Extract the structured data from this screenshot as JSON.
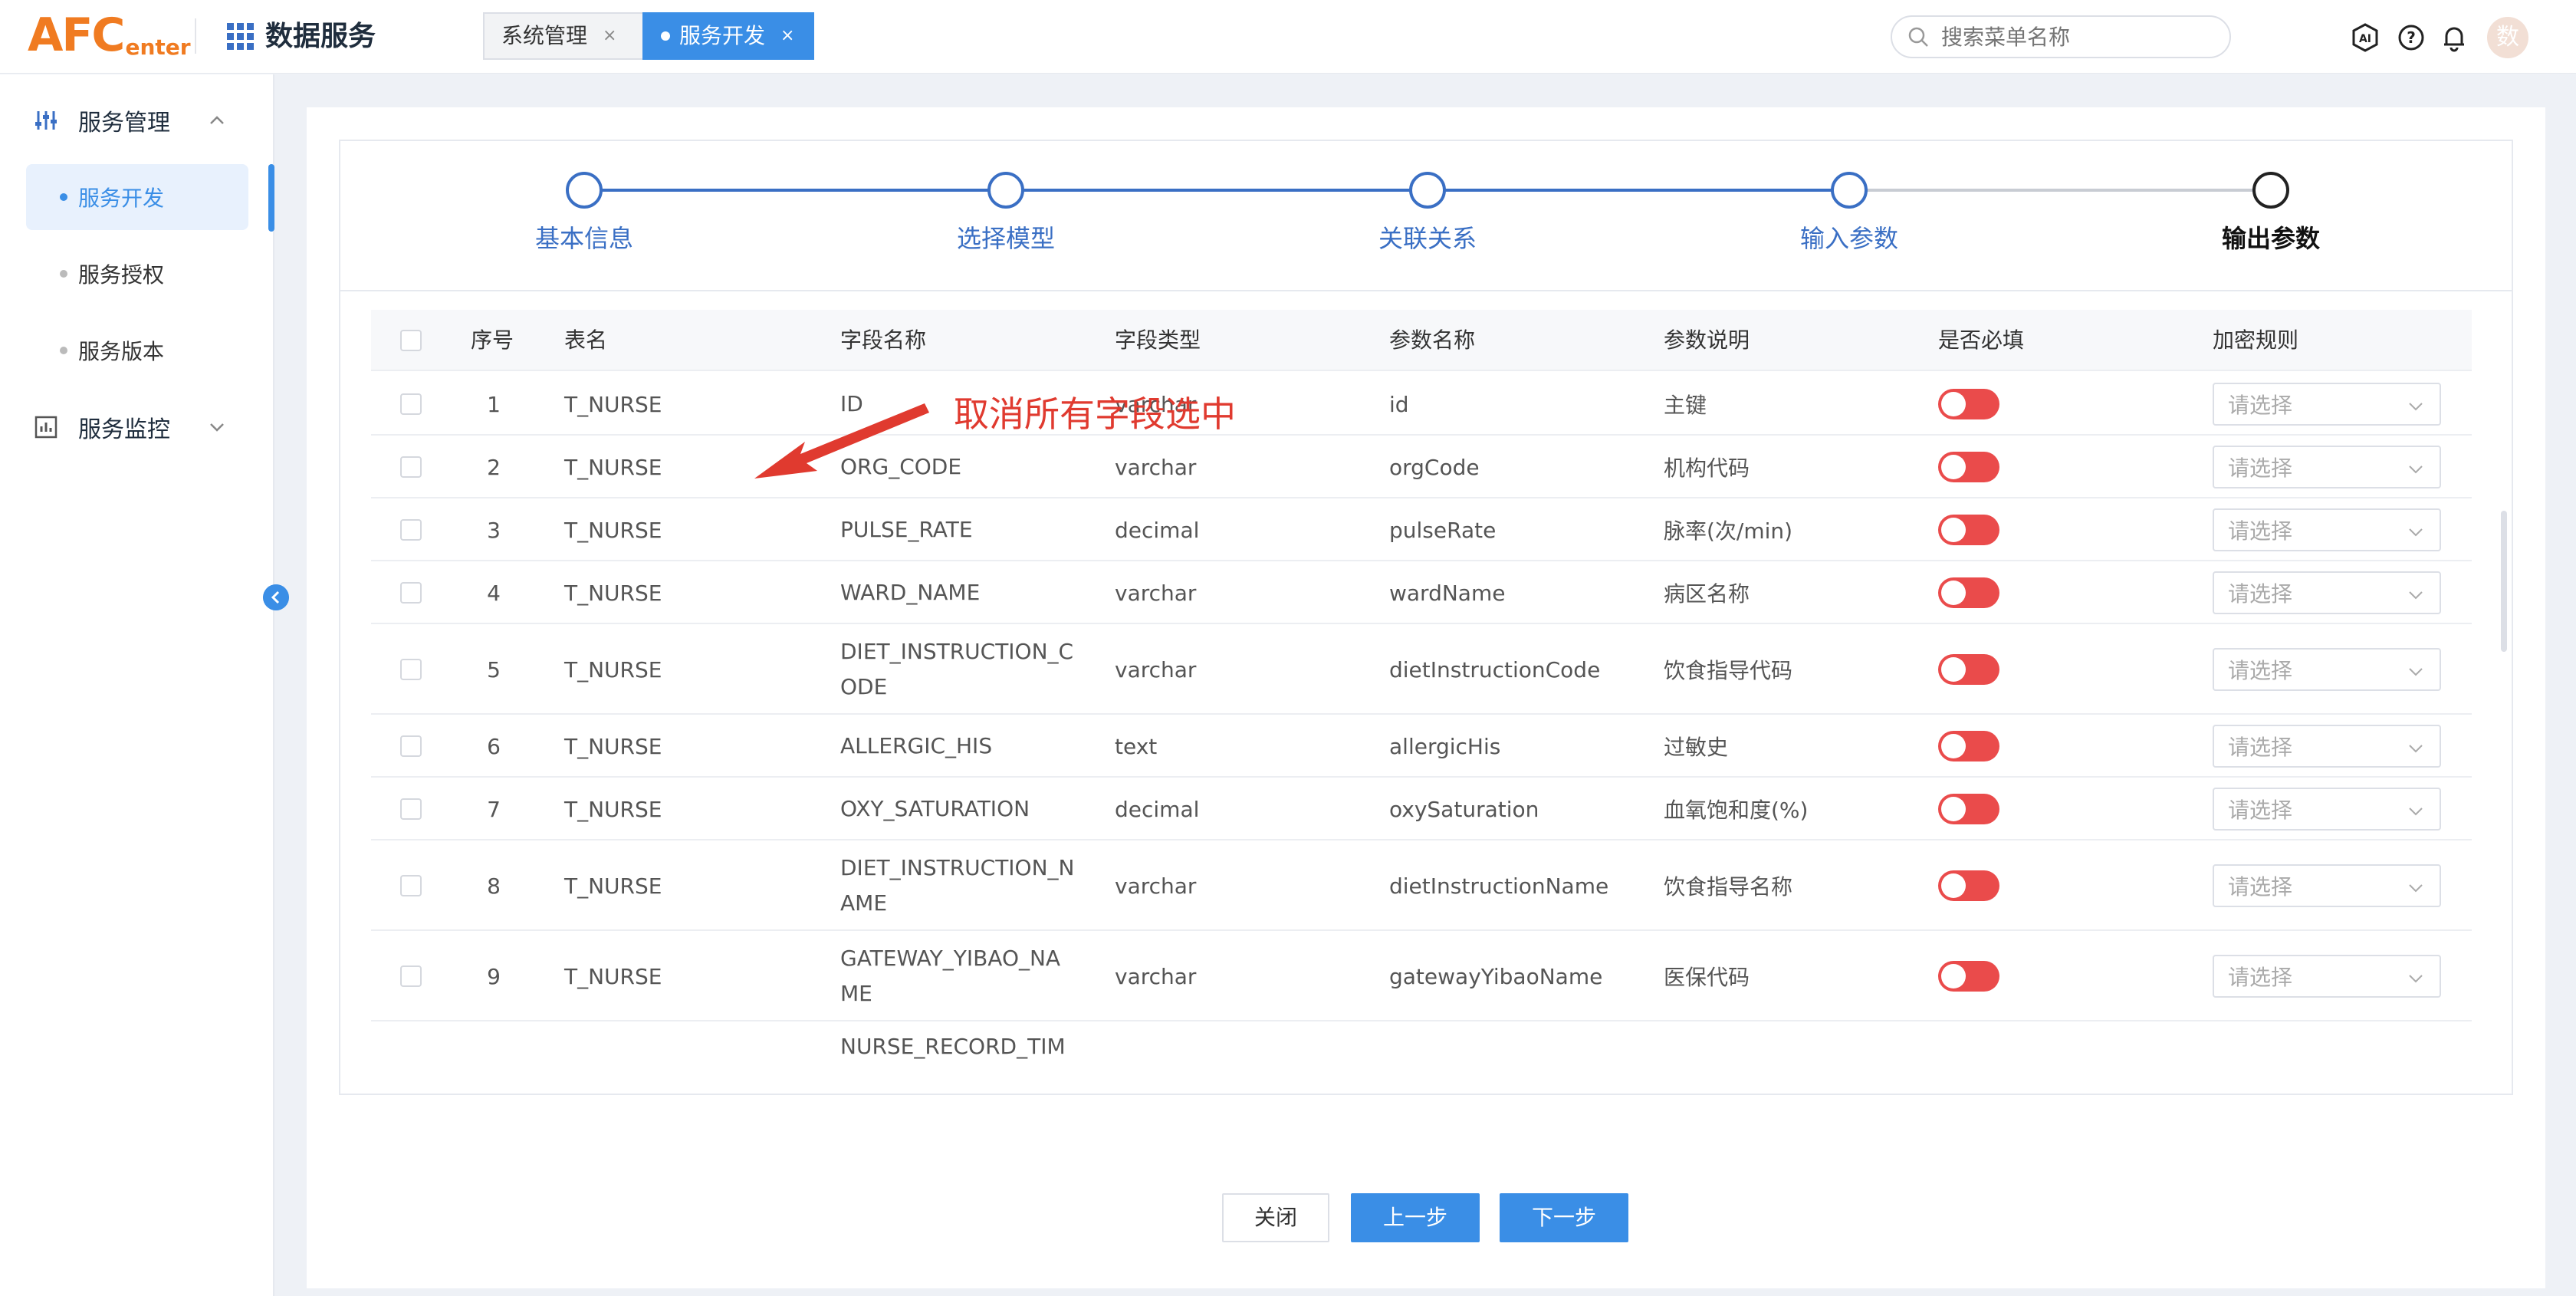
{
  "header": {
    "logo_big": "AFC",
    "logo_small": "enter",
    "app_title": "数据服务",
    "tabs": [
      {
        "label": "系统管理",
        "close": "×"
      },
      {
        "label": "服务开发",
        "close": "×"
      }
    ],
    "search_placeholder": "搜索菜单名称",
    "avatar_text": "数",
    "icons": [
      "ai-icon",
      "help-icon",
      "bell-icon"
    ]
  },
  "sidebar": {
    "groups": [
      {
        "label": "服务管理",
        "icon": "sliders-icon",
        "expanded": true
      },
      {
        "label": "服务监控",
        "icon": "chart-icon",
        "expanded": false
      }
    ],
    "items": [
      {
        "label": "服务开发",
        "active": true
      },
      {
        "label": "服务授权",
        "active": false
      },
      {
        "label": "服务版本",
        "active": false
      }
    ]
  },
  "steps": [
    "基本信息",
    "选择模型",
    "关联关系",
    "输入参数",
    "输出参数"
  ],
  "annotation": "取消所有字段选中",
  "table": {
    "headers": [
      "序号",
      "表名",
      "字段名称",
      "字段类型",
      "参数名称",
      "参数说明",
      "是否必填",
      "加密规则"
    ],
    "select_placeholder": "请选择",
    "rows": [
      {
        "no": "1",
        "table": "T_NURSE",
        "field": "ID",
        "type": "varchar",
        "param": "id",
        "desc": "主键"
      },
      {
        "no": "2",
        "table": "T_NURSE",
        "field": "ORG_CODE",
        "type": "varchar",
        "param": "orgCode",
        "desc": "机构代码"
      },
      {
        "no": "3",
        "table": "T_NURSE",
        "field": "PULSE_RATE",
        "type": "decimal",
        "param": "pulseRate",
        "desc": "脉率(次/min)"
      },
      {
        "no": "4",
        "table": "T_NURSE",
        "field": "WARD_NAME",
        "type": "varchar",
        "param": "wardName",
        "desc": "病区名称"
      },
      {
        "no": "5",
        "table": "T_NURSE",
        "field": "DIET_INSTRUCTION_CODE",
        "type": "varchar",
        "param": "dietInstructionCode",
        "desc": "饮食指导代码"
      },
      {
        "no": "6",
        "table": "T_NURSE",
        "field": "ALLERGIC_HIS",
        "type": "text",
        "param": "allergicHis",
        "desc": "过敏史"
      },
      {
        "no": "7",
        "table": "T_NURSE",
        "field": "OXY_SATURATION",
        "type": "decimal",
        "param": "oxySaturation",
        "desc": "血氧饱和度(%)"
      },
      {
        "no": "8",
        "table": "T_NURSE",
        "field": "DIET_INSTRUCTION_NAME",
        "type": "varchar",
        "param": "dietInstructionName",
        "desc": "饮食指导名称"
      },
      {
        "no": "9",
        "table": "T_NURSE",
        "field": "GATEWAY_YIBAO_NAME",
        "type": "varchar",
        "param": "gatewayYibaoName",
        "desc": "医保代码"
      },
      {
        "no": "",
        "table": "",
        "field": "NURSE_RECORD_TIM",
        "type": "",
        "param": "",
        "desc": ""
      }
    ]
  },
  "buttons": {
    "close": "关闭",
    "prev": "上一步",
    "next": "下一步"
  },
  "colors": {
    "primary": "#3a8ee6",
    "switch_off": "#ea4b4b",
    "annotation": "#e03a2f",
    "logo": "#f07b21"
  }
}
